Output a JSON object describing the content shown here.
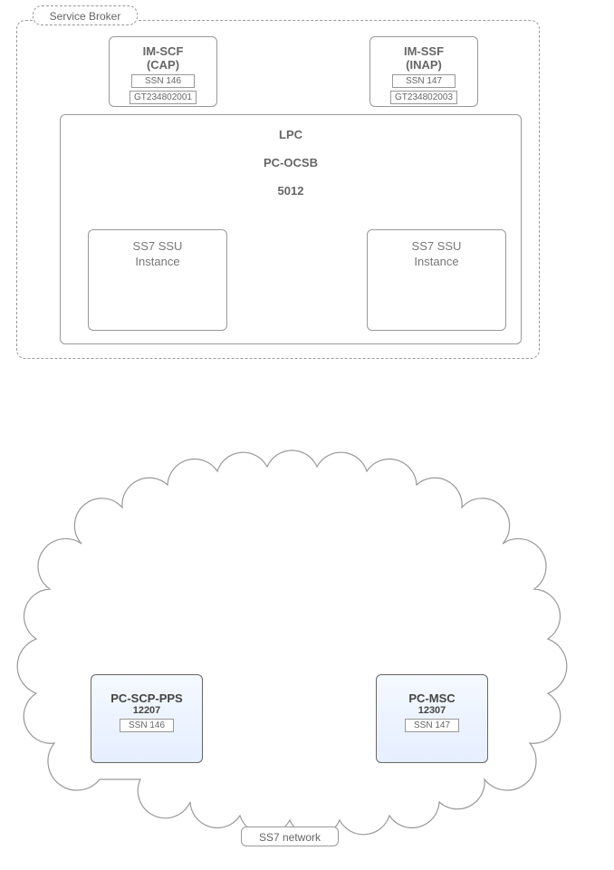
{
  "serviceBroker": {
    "title": "Service Broker",
    "im_scf": {
      "line1": "IM-SCF",
      "line2": "(CAP)",
      "ssn": "SSN 146",
      "gt": "GT234802001"
    },
    "im_ssf": {
      "line1": "IM-SSF",
      "line2": "(INAP)",
      "ssn": "SSN 147",
      "gt": "GT234802003"
    },
    "lpc": {
      "line1": "LPC",
      "line2": "PC-OCSB",
      "line3": "5012"
    },
    "ssu_left": {
      "line1": "SS7 SSU",
      "line2": "Instance"
    },
    "ssu_right": {
      "line1": "SS7 SSU",
      "line2": "Instance"
    }
  },
  "ss7": {
    "title": "SS7 network",
    "scp": {
      "name": "PC-SCP-PPS",
      "num": "12207",
      "ssn": "SSN 146"
    },
    "msc": {
      "name": "PC-MSC",
      "num": "12307",
      "ssn": "SSN 147"
    }
  }
}
